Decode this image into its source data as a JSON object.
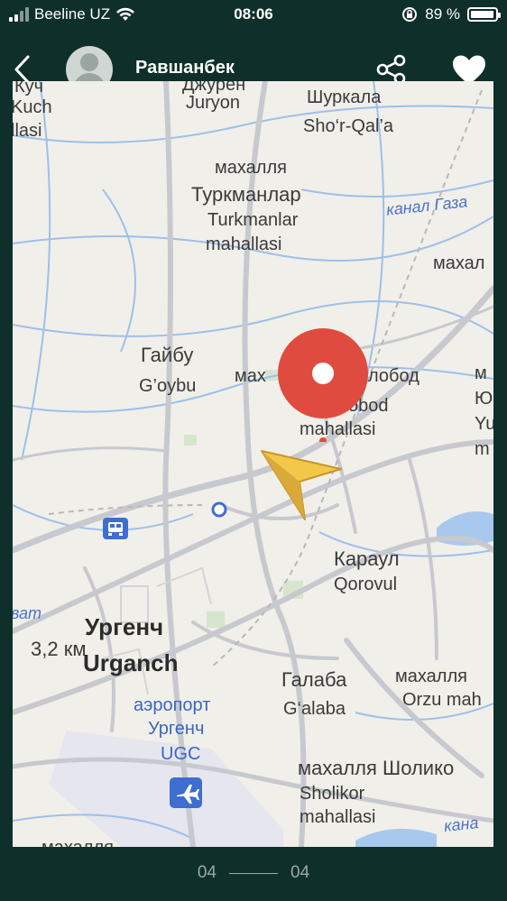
{
  "status_bar": {
    "carrier": "Beeline UZ",
    "time": "08:06",
    "battery": "89 %",
    "battery_level": 0.89
  },
  "header": {
    "user_name": "Равшанбек"
  },
  "map": {
    "labels": {
      "kuch": "Куч",
      "kuch_lat": "Kuch",
      "lasi": "llasi",
      "djuryon": "Джурён",
      "juryon": "Juryon",
      "shurkala": "Шуркала",
      "shoqala": "Sho‘r-Qal’a",
      "mahallya_1": "махалля",
      "turkmanlar": "Туркманлар",
      "turkmanlar_lat": "Turkmanlar",
      "mahallasi_1": "mahallasi",
      "kanal": "канал Газа",
      "mahal_right": "махал",
      "gaybu": "Гайбу",
      "goybu": "G’oybu",
      "mah_abod": "мах",
      "obod_cyr": "лобод",
      "obod_lat": "obod",
      "mahallasi_2": "mahallasi",
      "right_m": "м",
      "right_yu": "Ю",
      "right_yu_lat": "Yu",
      "right_m2": "m",
      "karaul": "Караул",
      "qorovul": "Qorovul",
      "vat": "ват",
      "urgench": "Ургенч",
      "urganch": "Urganch",
      "distance": "3,2 км",
      "aeroport": "аэропорт",
      "urgench_airport": "Ургенч",
      "ugc": "UGC",
      "galaba": "Галаба",
      "galaba_lat": "G‘alaba",
      "mahallya_orzu": "махалля",
      "orzu": "Orzu mah",
      "sholikor": "махалля Шолико",
      "sholikor_lat": "Sholikor",
      "mahallasi_3": "mahallasi",
      "kana_bottom": "кана",
      "mahallya_bottom": "махалля"
    }
  },
  "pager": {
    "left": "04",
    "right": "04"
  },
  "colors": {
    "background": "#0f2f2a",
    "map_bg": "#f1efe9",
    "pin": "#e04b3f",
    "arrow": "#f2c84b"
  }
}
